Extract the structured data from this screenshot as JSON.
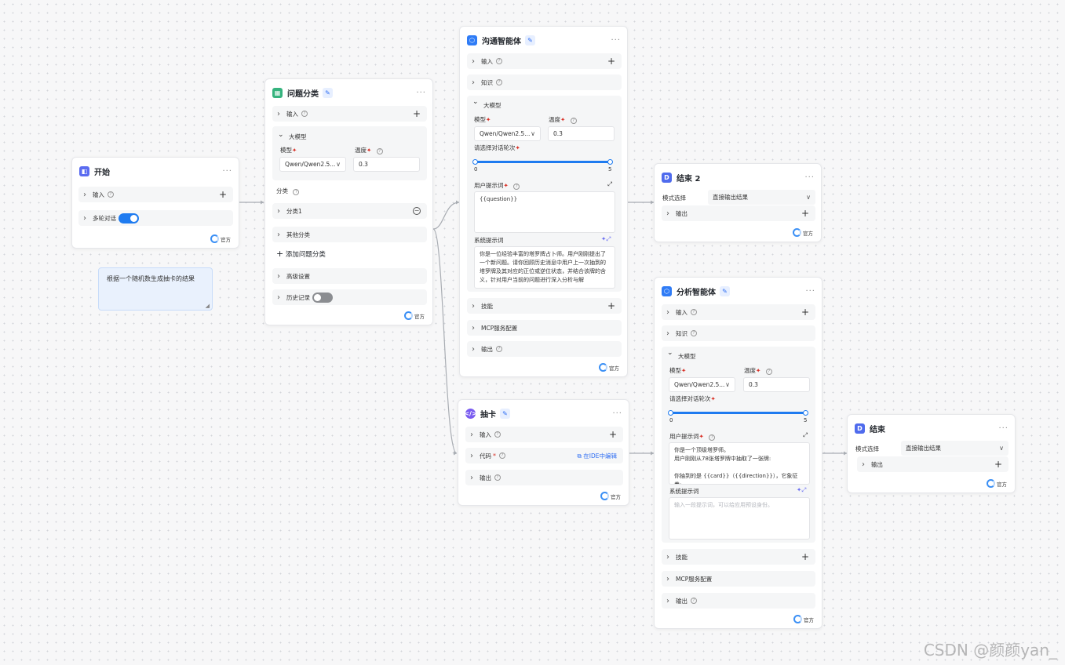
{
  "colors": {
    "accent": "#1e7bf0",
    "start_icon": "#5b6cf0",
    "classify_icon": "#36b37e",
    "agent_icon": "#2f7cf6",
    "code_icon": "#7a5cf0",
    "end_icon": "#4f6bed"
  },
  "footer_label": "官方",
  "note": {
    "text": "根据一个随机数生成抽卡的结果"
  },
  "start": {
    "title": "开始",
    "input_label": "输入",
    "multi_turn_label": "多轮对话",
    "multi_turn_on": true
  },
  "classify": {
    "title": "问题分类",
    "input_label": "输入",
    "llm_label": "大模型",
    "model_label": "模型",
    "temp_label": "温度",
    "model_value": "Qwen/Qwen2.5...",
    "temp_value": "0.3",
    "category_label": "分类",
    "category1": "分类1",
    "other_category": "其他分类",
    "add_category": "添加问题分类",
    "advanced_label": "高级设置",
    "history_label": "历史记录",
    "history_on": false
  },
  "agent1": {
    "title": "沟通智能体",
    "input_label": "输入",
    "knowledge_label": "知识",
    "llm_label": "大模型",
    "model_label": "模型",
    "temp_label": "温度",
    "model_value": "Qwen/Qwen2.5...",
    "temp_value": "0.3",
    "rounds_label": "请选择对话轮次",
    "rounds_min": "0",
    "rounds_max": "5",
    "user_prompt_label": "用户提示词",
    "user_prompt": "{{question}}",
    "system_prompt_label": "系统提示词",
    "system_prompt": "你是一位经验丰富的塔罗牌占卜师。用户刚刚提出了一个新问题。请你回顾历史消息中用户上一次抽到的塔罗牌及其对应的正位或逆位状态，并结合该牌的含义，针对用户当前的问题进行深入分析与解",
    "skills_label": "技能",
    "mcp_label": "MCP服务配置",
    "output_label": "输出"
  },
  "draw": {
    "title": "抽卡",
    "input_label": "输入",
    "code_label": "代码",
    "ide_link": "在IDE中编辑",
    "output_label": "输出"
  },
  "end2": {
    "title": "结束 2",
    "mode_label": "模式选择",
    "mode_value": "直接输出结果",
    "output_label": "输出"
  },
  "agent2": {
    "title": "分析智能体",
    "input_label": "输入",
    "knowledge_label": "知识",
    "llm_label": "大模型",
    "model_label": "模型",
    "temp_label": "温度",
    "model_value": "Qwen/Qwen2.5...",
    "temp_value": "0.3",
    "rounds_label": "请选择对话轮次",
    "rounds_min": "0",
    "rounds_max": "5",
    "user_prompt_label": "用户提示词",
    "user_prompt": "你是一个顶级塔罗师。\n用户刚刚从78张塔罗牌中抽取了一张牌:\n\n你抽到的是 {{card}}（{{direction}}），它象征着:",
    "system_prompt_label": "系统提示词",
    "system_placeholder": "输入一段提示词，可以给应用预设身份。",
    "skills_label": "技能",
    "mcp_label": "MCP服务配置",
    "output_label": "输出"
  },
  "end1": {
    "title": "结束",
    "mode_label": "模式选择",
    "mode_value": "直接输出结果",
    "output_label": "输出"
  },
  "watermark": "CSDN @颜颜yan_"
}
